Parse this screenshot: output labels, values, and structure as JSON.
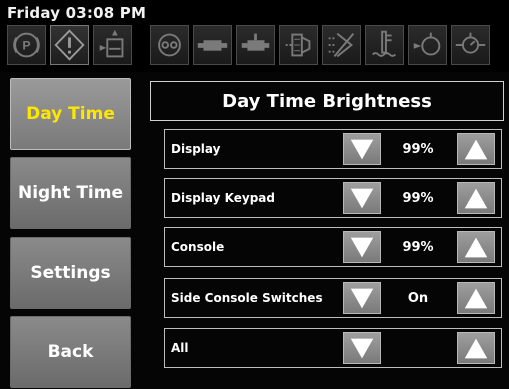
{
  "status": {
    "datetime": "Friday 03:08 PM"
  },
  "indicators": [
    {
      "icon": "parking-brake-icon"
    },
    {
      "icon": "warning-icon"
    },
    {
      "icon": "hydraulic-oil-icon"
    },
    {
      "icon": "engine-icon"
    },
    {
      "icon": "transmission-icon"
    },
    {
      "icon": "transmission-temp-icon"
    },
    {
      "icon": "air-filter-icon"
    },
    {
      "icon": "fuel-filter-icon"
    },
    {
      "icon": "coolant-icon"
    },
    {
      "icon": "charge-pressure-icon"
    },
    {
      "icon": "oil-pressure-icon"
    }
  ],
  "menu": {
    "day_time": "Day Time",
    "night_time": "Night Time",
    "settings": "Settings",
    "back": "Back"
  },
  "panel": {
    "title": "Day Time Brightness",
    "rows": [
      {
        "label": "Display",
        "value": "99%"
      },
      {
        "label": "Display Keypad",
        "value": "99%"
      },
      {
        "label": "Console",
        "value": "99%"
      },
      {
        "label": "Side Console Switches",
        "value": "On"
      },
      {
        "label": "All",
        "value": ""
      }
    ]
  },
  "colors": {
    "active_menu_text": "#ffe600",
    "button_gray": "#8c8c8c",
    "background": "#050505"
  }
}
